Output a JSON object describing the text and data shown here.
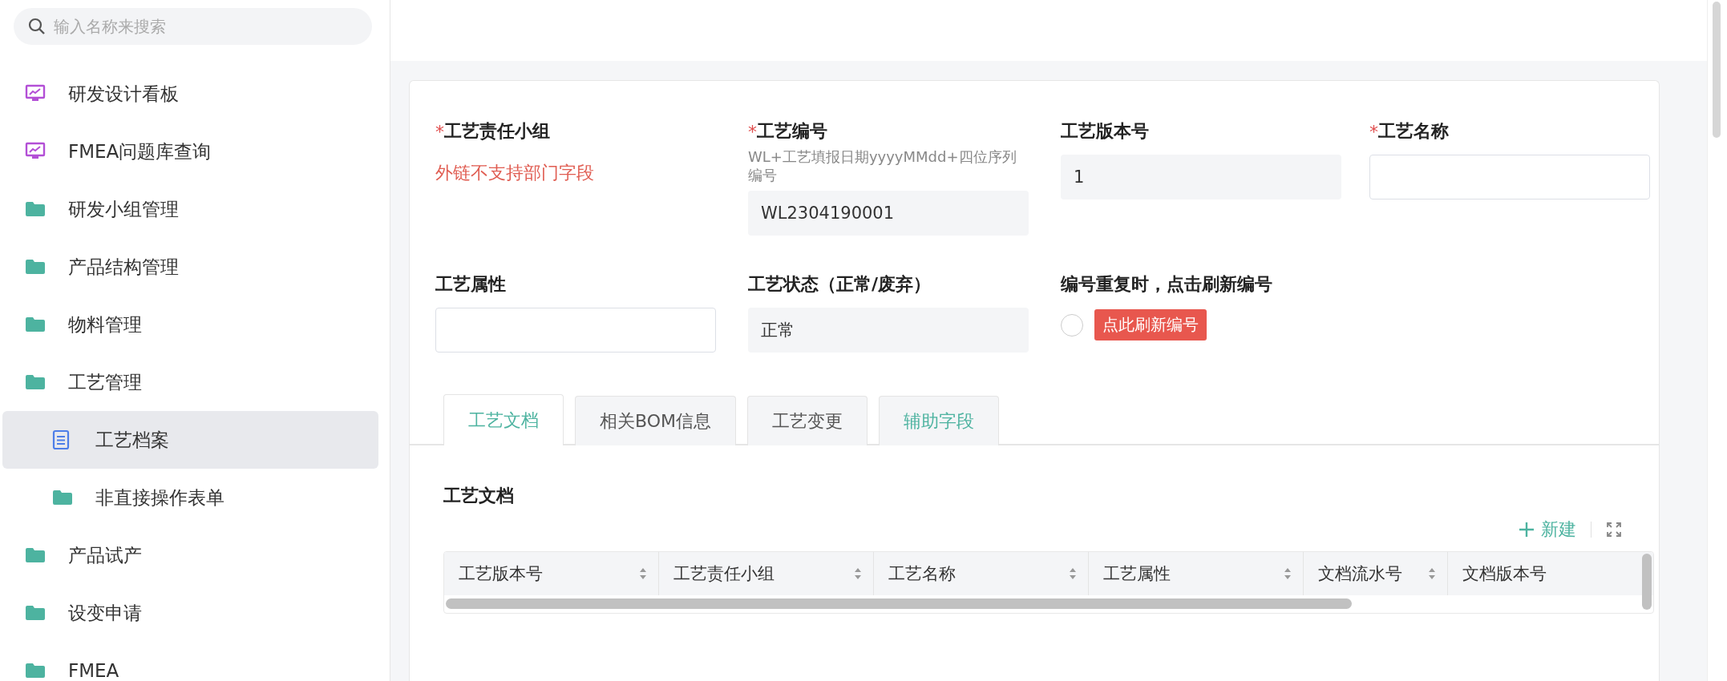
{
  "sidebar": {
    "search": {
      "placeholder": "输入名称来搜索"
    },
    "items": [
      {
        "label": "研发设计看板",
        "kind": "board",
        "selected": false
      },
      {
        "label": "FMEA问题库查询",
        "kind": "board",
        "selected": false
      },
      {
        "label": "研发小组管理",
        "kind": "folder",
        "selected": false
      },
      {
        "label": "产品结构管理",
        "kind": "folder",
        "selected": false
      },
      {
        "label": "物料管理",
        "kind": "folder",
        "selected": false
      },
      {
        "label": "工艺管理",
        "kind": "folder",
        "selected": false,
        "children": [
          {
            "label": "工艺档案",
            "kind": "document",
            "selected": true
          },
          {
            "label": "非直接操作表单",
            "kind": "folder",
            "selected": false
          }
        ]
      },
      {
        "label": "产品试产",
        "kind": "folder",
        "selected": false
      },
      {
        "label": "设变申请",
        "kind": "folder",
        "selected": false
      },
      {
        "label": "FMEA",
        "kind": "folder",
        "selected": false
      }
    ]
  },
  "form": {
    "fields": [
      {
        "mark": "*",
        "label": "工艺责任小组",
        "kind": "note",
        "value": "外链不支持部门字段"
      },
      {
        "mark": "*",
        "label": "工艺编号",
        "kind": "readonly",
        "hint": "WL+工艺填报日期yyyyMMdd+四位序列编号",
        "value": "WL2304190001"
      },
      {
        "label": "工艺版本号",
        "kind": "readonly",
        "value": "1"
      },
      {
        "mark": "*",
        "label": "工艺名称",
        "kind": "input"
      },
      {
        "label": "工艺属性",
        "kind": "input"
      },
      {
        "label": "工艺状态（正常/废弃）",
        "kind": "readonly",
        "value": "正常"
      },
      {
        "label": "编号重复时，点击刷新编号",
        "kind": "refresh",
        "checked": false,
        "button": "点此刷新编号"
      }
    ]
  },
  "tabs": [
    {
      "label": "工艺文档",
      "selected": true,
      "accent": true
    },
    {
      "label": "相关BOM信息",
      "selected": false,
      "accent": false
    },
    {
      "label": "工艺变更",
      "selected": false,
      "accent": false
    },
    {
      "label": "辅助字段",
      "selected": false,
      "accent": true
    }
  ],
  "section": {
    "title": "工艺文档",
    "new_button": "新建",
    "table": {
      "columns": [
        {
          "label": "工艺版本号",
          "sortable": true
        },
        {
          "label": "工艺责任小组",
          "sortable": true
        },
        {
          "label": "工艺名称",
          "sortable": true
        },
        {
          "label": "工艺属性",
          "sortable": true
        },
        {
          "label": "文档流水号",
          "sortable": true
        },
        {
          "label": "文档版本号",
          "sortable": false
        }
      ]
    }
  }
}
